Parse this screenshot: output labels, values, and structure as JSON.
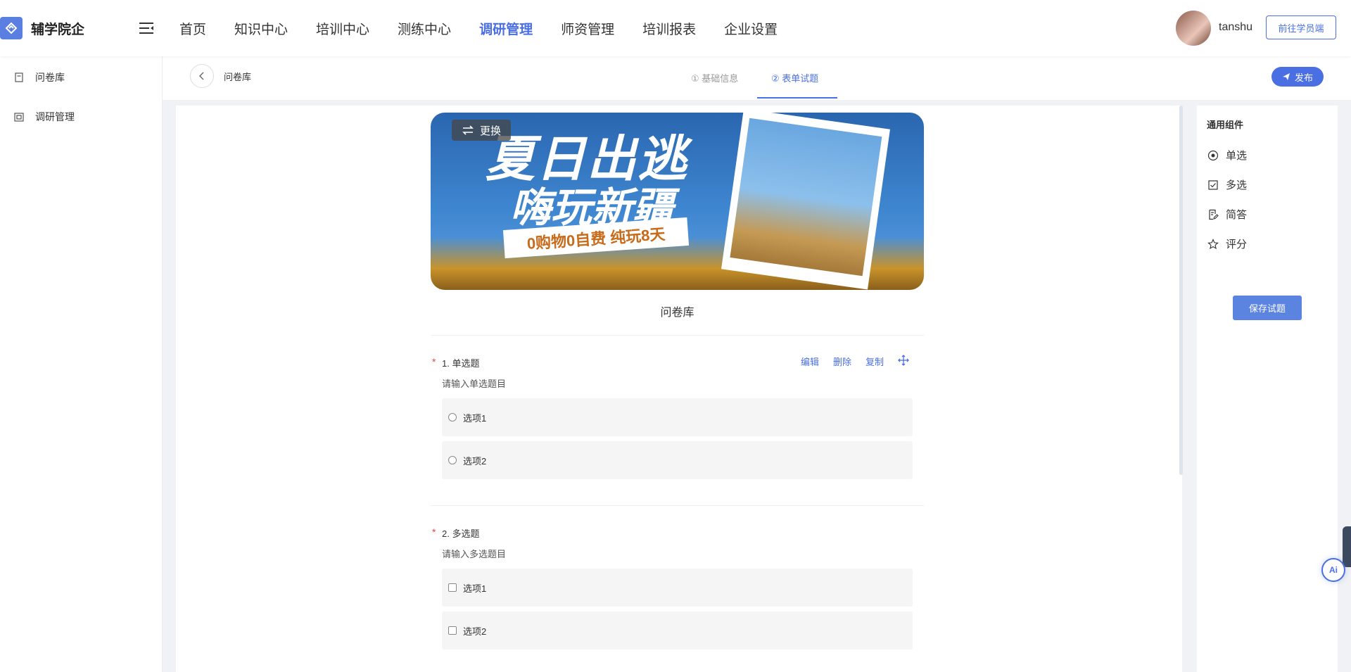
{
  "app": {
    "name": "辅学院企"
  },
  "nav": {
    "items": [
      {
        "label": "首页"
      },
      {
        "label": "知识中心"
      },
      {
        "label": "培训中心"
      },
      {
        "label": "测练中心"
      },
      {
        "label": "调研管理"
      },
      {
        "label": "师资管理"
      },
      {
        "label": "培训报表"
      },
      {
        "label": "企业设置"
      }
    ],
    "active": "调研管理"
  },
  "user": {
    "name": "tanshu",
    "student_button": "前往学员端"
  },
  "sidebar": {
    "items": [
      {
        "label": "问卷库",
        "icon": "document-icon"
      },
      {
        "label": "调研管理",
        "icon": "survey-icon"
      }
    ]
  },
  "subheader": {
    "breadcrumb": "问卷库",
    "steps": [
      {
        "label": "① 基础信息"
      },
      {
        "label": "② 表单试题"
      }
    ],
    "active_step": 1,
    "publish_label": "发布"
  },
  "banner": {
    "change_label": "更换",
    "headline_1": "夏日出逃",
    "headline_2": "嗨玩新疆",
    "strip": "0购物0自费 纯玩8天"
  },
  "form": {
    "title": "问卷库",
    "questions": [
      {
        "title": "1. 单选题",
        "description": "请输入单选题目",
        "options": [
          "选项1",
          "选项2"
        ],
        "actions": [
          "编辑",
          "删除",
          "复制"
        ]
      },
      {
        "title": "2. 多选题",
        "description": "请输入多选题目",
        "options": [
          "选项1",
          "选项2"
        ]
      }
    ]
  },
  "components_panel": {
    "title": "通用组件",
    "items": [
      {
        "label": "单选",
        "icon": "radio-icon"
      },
      {
        "label": "多选",
        "icon": "checkbox-icon"
      },
      {
        "label": "简答",
        "icon": "edit-doc-icon"
      },
      {
        "label": "评分",
        "icon": "star-icon"
      }
    ],
    "save_label": "保存试题"
  },
  "ai_button": "Ai",
  "colors": {
    "accent": "#4a6fe3",
    "required": "#e54545"
  }
}
